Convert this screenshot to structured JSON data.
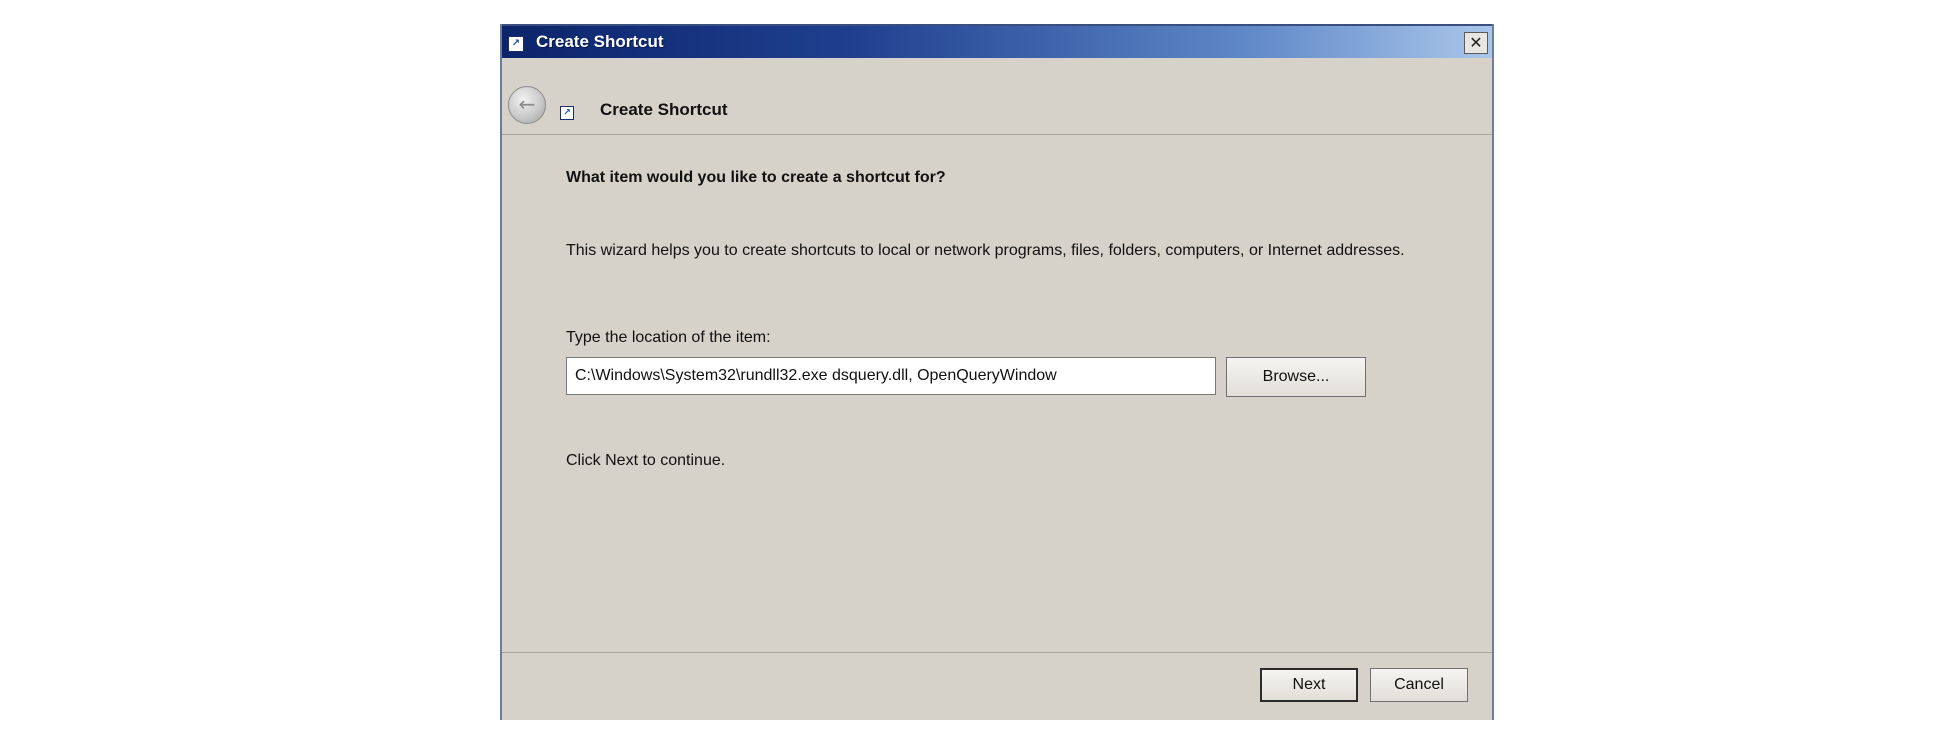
{
  "window": {
    "title": "Create Shortcut",
    "close_glyph": "✕"
  },
  "header": {
    "back_glyph": "←",
    "title": "Create Shortcut"
  },
  "content": {
    "question": "What item would you like to create a shortcut for?",
    "description": "This wizard helps you to create shortcuts to local or network programs, files, folders, computers, or Internet addresses.",
    "location_label": "Type the location of the item:",
    "location_value": "C:\\Windows\\System32\\rundll32.exe dsquery.dll, OpenQueryWindow",
    "browse_label": "Browse...",
    "hint": "Click Next to continue."
  },
  "footer": {
    "next_label": "Next",
    "cancel_label": "Cancel"
  },
  "icons": {
    "title": "shortcut-icon",
    "header": "shortcut-icon",
    "back": "back-arrow-icon",
    "close": "close-icon"
  }
}
